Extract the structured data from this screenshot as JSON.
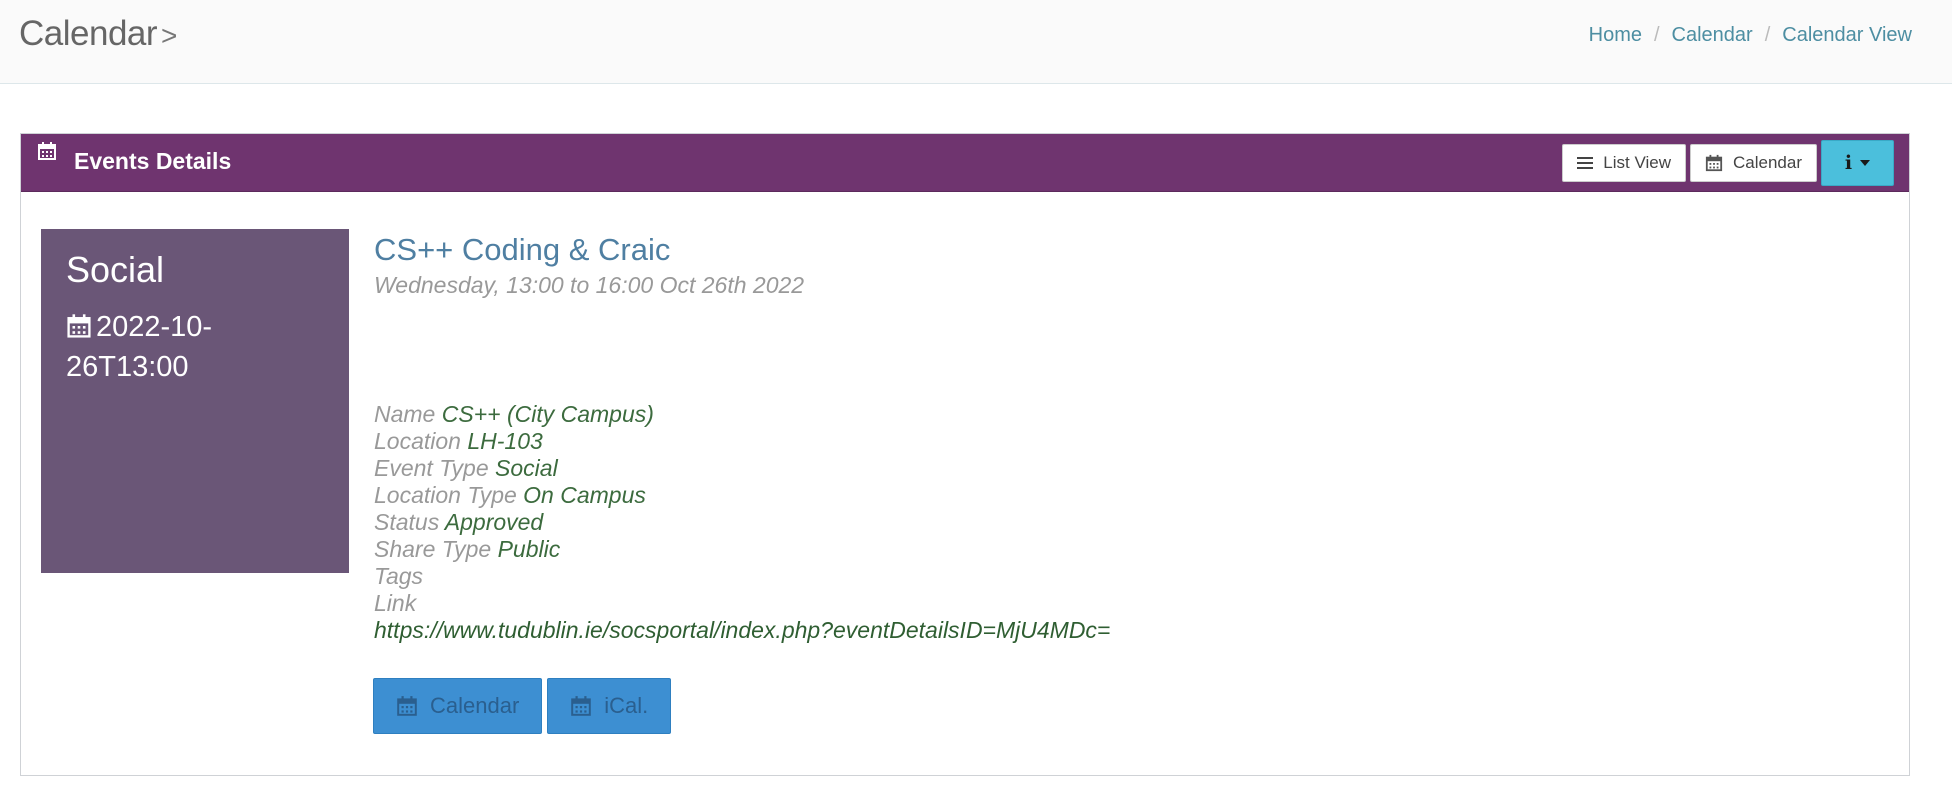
{
  "header": {
    "title": "Calendar",
    "title_chevron": ">",
    "breadcrumb": [
      {
        "label": "Home"
      },
      {
        "label": "Calendar"
      },
      {
        "label": "Calendar View"
      }
    ],
    "breadcrumb_sep": "/"
  },
  "panel": {
    "title": "Events Details",
    "heading_color": "#6f346f",
    "toolbar": {
      "list_view_label": "List View",
      "calendar_label": "Calendar",
      "info_glyph": "i",
      "info_color": "#4bbfdc"
    }
  },
  "tile": {
    "category": "Social",
    "datetime": "2022-10-26T13:00",
    "color": "#6a5677"
  },
  "event": {
    "title": "CS++ Coding & Craic",
    "when": "Wednesday, 13:00 to 16:00 Oct 26th 2022",
    "details": {
      "name_label": "Name",
      "name_value": "CS++ (City Campus)",
      "location_label": "Location",
      "location_value": "LH-103",
      "event_type_label": "Event Type",
      "event_type_value": "Social",
      "location_type_label": "Location Type",
      "location_type_value": "On Campus",
      "status_label": "Status",
      "status_value": "Approved",
      "share_type_label": "Share Type",
      "share_type_value": "Public",
      "tags_label": "Tags",
      "link_label": "Link",
      "link_value": "https://www.tudublin.ie/socsportal/index.php?eventDetailsID=MjU4MDc="
    },
    "actions": {
      "calendar_label": "Calendar",
      "ical_label": "iCal."
    }
  },
  "icons": {
    "calendar": "calendar-icon",
    "list": "list-icon",
    "info": "info-icon",
    "caret": "caret-down-icon"
  }
}
